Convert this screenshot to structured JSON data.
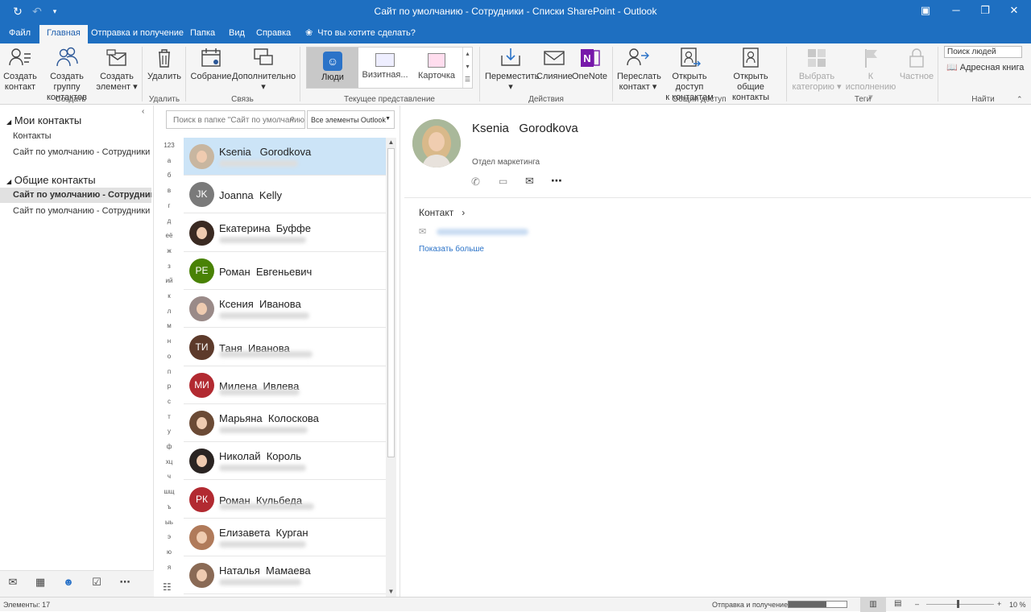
{
  "window": {
    "title": "Сайт по умолчанию - Сотрудники - Списки SharePoint  -  Outlook"
  },
  "tabs": [
    "Файл",
    "Главная",
    "Отправка и получение",
    "Папка",
    "Вид",
    "Справка"
  ],
  "tell_me": "Что вы хотите сделать?",
  "ribbon": {
    "create": {
      "new_contact": [
        "Создать",
        "контакт"
      ],
      "new_group": [
        "Создать группу",
        "контактов"
      ],
      "new_item": [
        "Создать",
        "элемент"
      ],
      "label": "Создать"
    },
    "delete": {
      "delete": "Удалить",
      "label": "Удалить"
    },
    "communicate": {
      "meeting": "Собрание",
      "more": "Дополнительно",
      "label": "Связь"
    },
    "view": {
      "people": "Люди",
      "business_card": "Визитная...",
      "card": "Карточка",
      "label": "Текущее представление"
    },
    "actions": {
      "move": "Переместить",
      "merge": "Слияние",
      "onenote": "OneNote",
      "label": "Действия"
    },
    "share": {
      "forward": [
        "Переслать",
        "контакт"
      ],
      "open_access": [
        "Открыть доступ",
        "к контактам"
      ],
      "open_shared": [
        "Открыть общие",
        "контакты"
      ],
      "label": "Общий доступ"
    },
    "tags": {
      "categorize": [
        "Выбрать",
        "категорию"
      ],
      "followup": "К исполнению",
      "private": "Частное",
      "label": "Теги"
    },
    "find": {
      "search_people": "Поиск людей",
      "address_book": "Адресная книга",
      "label": "Найти"
    }
  },
  "nav": {
    "my_contacts": "Мои контакты",
    "my_items": [
      "Контакты",
      "Сайт по умолчанию - Сотрудники - Списки SharePoint"
    ],
    "shared_contacts": "Общие контакты",
    "shared_items": [
      "Сайт по умолчанию - Сотрудники",
      "Сайт по умолчанию - Сотрудники - Списки SharePoint"
    ]
  },
  "search": {
    "placeholder": "Поиск в папке \"Сайт по умолчанию - Сотрудники\"",
    "scope": "Все элементы Outlook"
  },
  "alphabet": [
    "123",
    "а",
    "б",
    "в",
    "г",
    "д",
    "её",
    "ж",
    "з",
    "ий",
    "к",
    "л",
    "м",
    "н",
    "о",
    "п",
    "р",
    "с",
    "т",
    "у",
    "ф",
    "хц",
    "ч",
    "шщ",
    "ъ",
    "ыь",
    "э",
    "ю",
    "я"
  ],
  "contacts": [
    {
      "name": "Ksenia   Gorodkova",
      "initials": "",
      "color": "#c8b6a0",
      "photo": true
    },
    {
      "name": "Joanna  Kelly",
      "initials": "JK",
      "color": "#7a7a7a",
      "photo": false
    },
    {
      "name": "Екатерина  Буффе",
      "initials": "",
      "color": "#3a2a22",
      "photo": true
    },
    {
      "name": "Роман  Евгеньевич",
      "initials": "РЕ",
      "color": "#498205",
      "photo": false
    },
    {
      "name": "Ксения  Иванова",
      "initials": "",
      "color": "#9a8a88",
      "photo": true
    },
    {
      "name": "Таня  Иванова",
      "initials": "ТИ",
      "color": "#5d3a2b",
      "photo": false
    },
    {
      "name": "Милена  Ивлева",
      "initials": "МИ",
      "color": "#b22a31",
      "photo": false
    },
    {
      "name": "Марьяна  Колоскова",
      "initials": "",
      "color": "#6b4a35",
      "photo": true
    },
    {
      "name": "Николай  Король",
      "initials": "",
      "color": "#2a2422",
      "photo": true
    },
    {
      "name": "Роман  Кульбеда",
      "initials": "РК",
      "color": "#b22a31",
      "photo": false
    },
    {
      "name": "Елизавета  Курган",
      "initials": "",
      "color": "#b07a5a",
      "photo": true
    },
    {
      "name": "Наталья  Мамаева",
      "initials": "",
      "color": "#8a6a55",
      "photo": true
    }
  ],
  "detail": {
    "name": "Ksenia   Gorodkova",
    "department": "Отдел маркетинга",
    "section": "Контакт",
    "show_more": "Показать больше"
  },
  "status": {
    "items": "Элементы: 17",
    "send_receive": "Отправка и получение",
    "zoom": "10 %",
    "progress": 0.65
  }
}
